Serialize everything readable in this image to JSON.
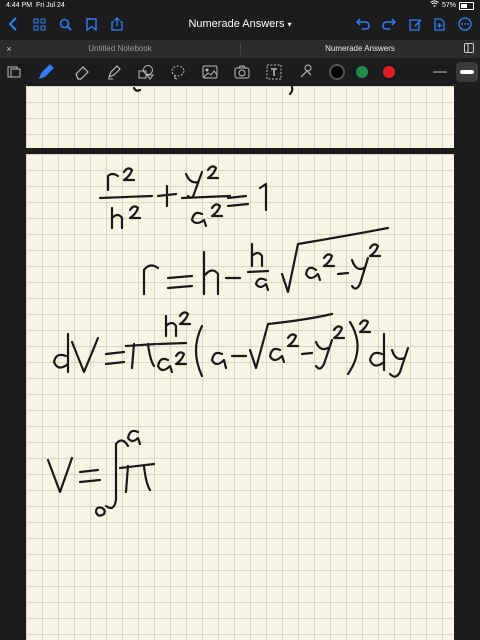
{
  "status": {
    "time": "4:44 PM",
    "date": "Fri Jul 24",
    "battery": "57%"
  },
  "nav": {
    "title": "Numerade Answers",
    "title_chevron": "▾"
  },
  "tabs": [
    {
      "label": "Untitled Notebook",
      "close": "×"
    },
    {
      "label": "Numerade Answers",
      "close": ""
    }
  ],
  "toolbar": {
    "tools": [
      "scan-icon",
      "pen-icon",
      "eraser-icon",
      "highlighter-icon",
      "shapes-icon",
      "lasso-icon",
      "image-icon",
      "camera-icon",
      "text-icon",
      "elements-icon"
    ],
    "colors": [
      "#000000",
      "#1f8a4c",
      "#e02020"
    ],
    "accent": "#2f7ef6"
  }
}
